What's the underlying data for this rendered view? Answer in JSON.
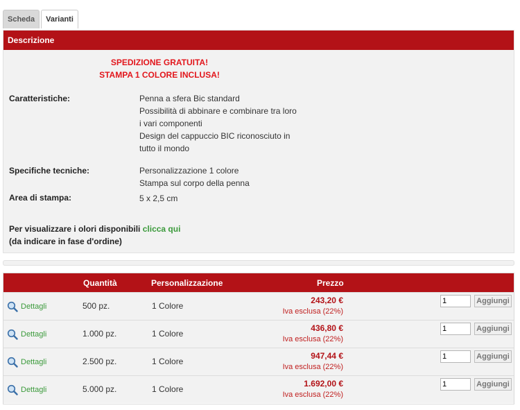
{
  "tabs": [
    {
      "label": "Scheda"
    },
    {
      "label": "Varianti"
    }
  ],
  "description": {
    "header": "Descrizione",
    "promo": [
      "SPEDIZIONE GRATUITA!",
      "STAMPA 1 COLORE INCLUSA!"
    ],
    "caratteristiche_label": "Caratteristiche:",
    "caratteristiche": [
      "Penna a sfera Bic standard",
      "Possibilità di abbinare e combinare tra loro",
      "i vari componenti",
      "Design del cappuccio BIC riconosciuto in",
      "tutto il mondo"
    ],
    "specifiche_label": "Specifiche tecniche:",
    "specifiche": [
      "Personalizzazione 1 colore",
      "Stampa sul corpo della penna"
    ],
    "area_label": "Area di stampa:",
    "area_value": "5 x 2,5 cm",
    "note_text": "Per visualizzare i olori disponibili",
    "note_link": "clicca qui",
    "note_sub": "(da indicare in fase d'ordine)"
  },
  "price_table": {
    "headers": {
      "qty": "Quantità",
      "pers": "Personalizzazione",
      "price": "Prezzo"
    },
    "details_label": "Dettagli",
    "vat_label": "Iva esclusa (22%)",
    "add_label": "Aggiungi",
    "rows": [
      {
        "qty": "500 pz.",
        "pers": "1 Colore",
        "price": "243,20 €",
        "input": "1"
      },
      {
        "qty": "1.000 pz.",
        "pers": "1 Colore",
        "price": "436,80 €",
        "input": "1"
      },
      {
        "qty": "2.500 pz.",
        "pers": "1 Colore",
        "price": "947,44 €",
        "input": "1"
      },
      {
        "qty": "5.000 pz.",
        "pers": "1 Colore",
        "price": "1.692,00 €",
        "input": "1"
      }
    ]
  },
  "colors": {
    "accent": "#b31217",
    "link": "#3b9a3b",
    "promo": "#e2161c",
    "panel": "#f2f2f2"
  },
  "icons": {
    "details": "magnifier-icon"
  }
}
